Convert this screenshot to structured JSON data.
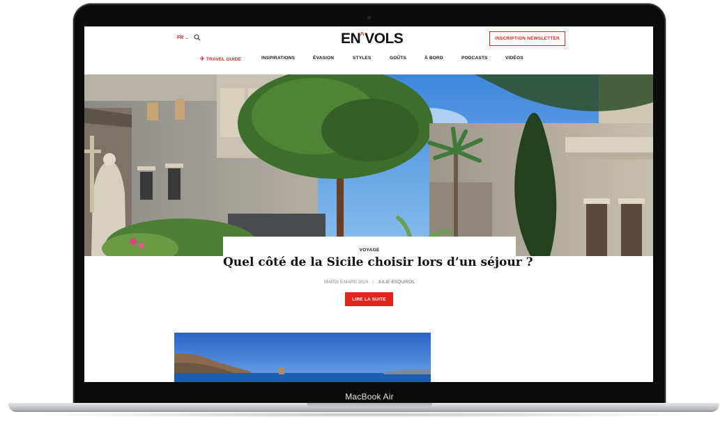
{
  "device": {
    "label": "MacBook Air"
  },
  "header": {
    "language": "FR",
    "logo": {
      "left": "EN",
      "mark": "^",
      "right": "VOLS"
    },
    "newsletter_label": "INSCRIPTION NEWSLETTER"
  },
  "nav": [
    {
      "label": "TRAVEL GUIDE",
      "icon": "plane-icon",
      "highlight": true
    },
    {
      "label": "INSPIRATIONS"
    },
    {
      "label": "ÉVASION"
    },
    {
      "label": "STYLES"
    },
    {
      "label": "GOÛTS"
    },
    {
      "label": "À BORD"
    },
    {
      "label": "PODCASTS"
    },
    {
      "label": "VIDÉOS"
    }
  ],
  "article": {
    "category": "VOYAGE",
    "title": "Quel côté de la Sicile choisir lors d’un séjour ?",
    "date": "MARDI 5 MARS 2024",
    "separator": "|",
    "author": "JULIE ESQUIROL",
    "cta": "LIRE LA SUITE"
  },
  "colors": {
    "accent": "#e2231a",
    "text": "#111111",
    "muted": "#888888",
    "sky": "#5fa0e0",
    "sea": "#1a5fb0"
  }
}
